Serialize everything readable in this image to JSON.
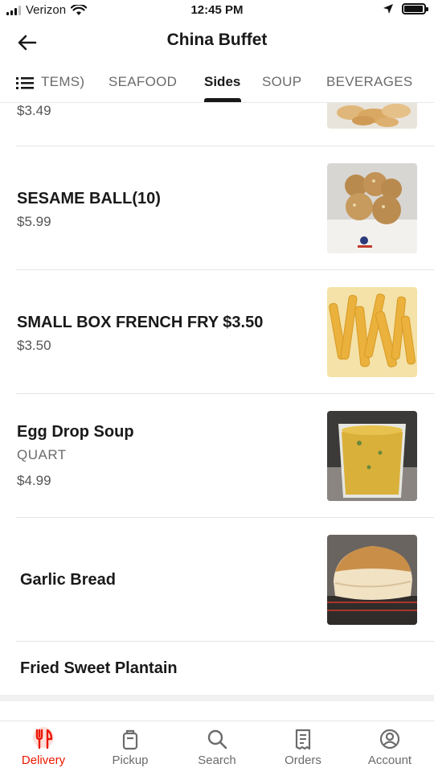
{
  "status": {
    "carrier": "Verizon",
    "time": "12:45 PM"
  },
  "header": {
    "title": "China Buffet"
  },
  "tabs": [
    {
      "label": "TEMS)",
      "active": false
    },
    {
      "label": "SEAFOOD",
      "active": false
    },
    {
      "label": "Sides",
      "active": true
    },
    {
      "label": "SOUP",
      "active": false
    },
    {
      "label": "BEVERAGES",
      "active": false
    }
  ],
  "items": [
    {
      "name": "",
      "price": "$3.49"
    },
    {
      "name": "SESAME BALL(10)",
      "price": "$5.99"
    },
    {
      "name": "SMALL BOX FRENCH FRY  $3.50",
      "price": "$3.50"
    },
    {
      "name": "Egg Drop Soup",
      "description": "QUART",
      "price": "$4.99"
    },
    {
      "name": "Garlic Bread"
    },
    {
      "name": "Fried Sweet Plantain"
    }
  ],
  "nav": [
    {
      "label": "Delivery",
      "icon": "fork-knife-icon",
      "active": true
    },
    {
      "label": "Pickup",
      "icon": "bag-icon",
      "active": false
    },
    {
      "label": "Search",
      "icon": "search-icon",
      "active": false
    },
    {
      "label": "Orders",
      "icon": "receipt-icon",
      "active": false
    },
    {
      "label": "Account",
      "icon": "account-icon",
      "active": false
    }
  ],
  "colors": {
    "accent": "#eb1700",
    "text": "#191919",
    "muted": "#6b6b6b"
  }
}
